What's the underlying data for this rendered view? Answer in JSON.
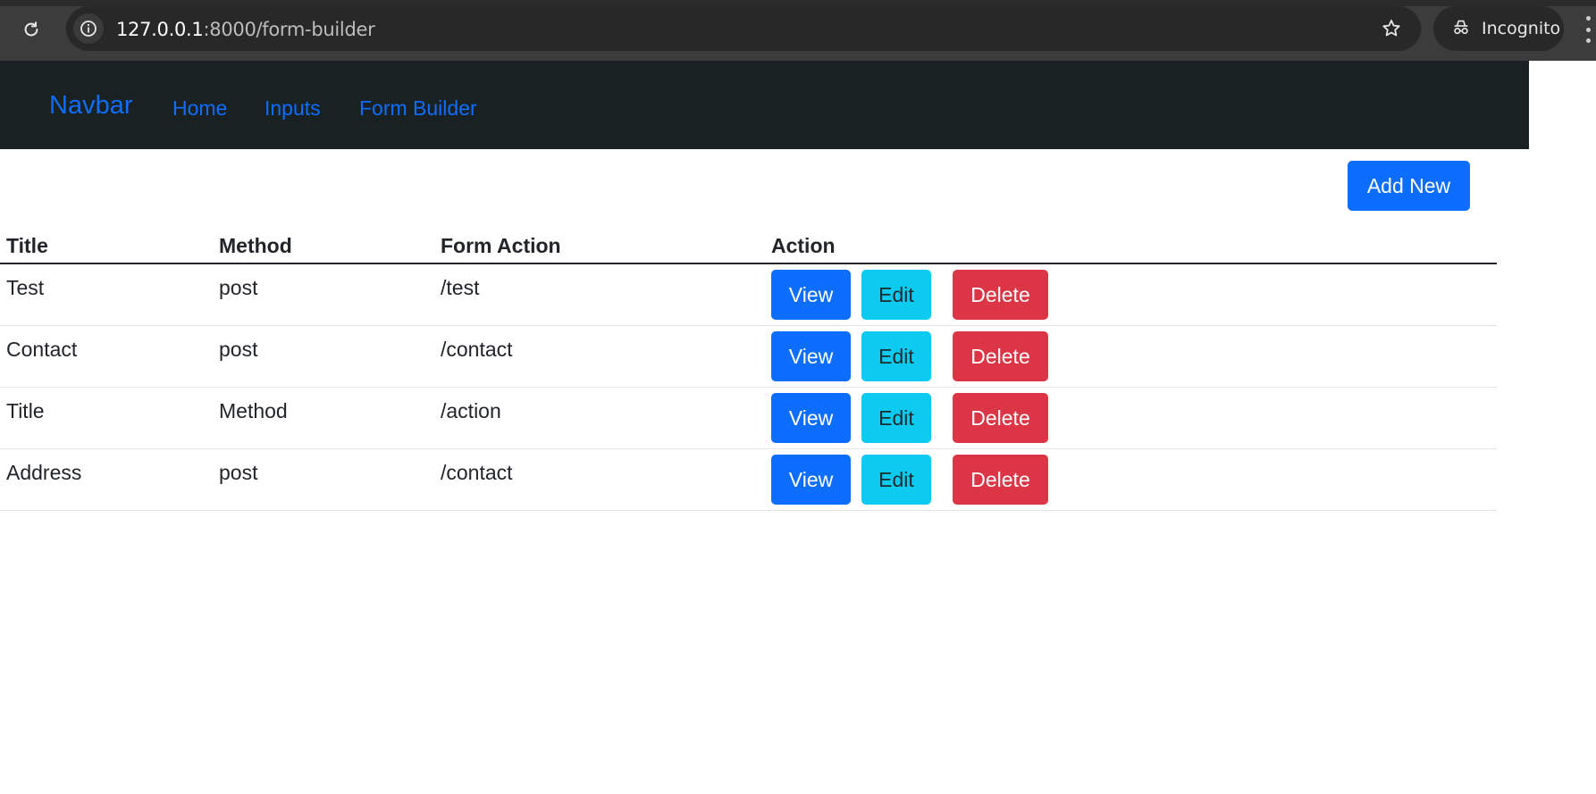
{
  "browser": {
    "url_host": "127.0.0.1",
    "url_path": ":8000/form-builder",
    "incognito_label": "Incognito"
  },
  "navbar": {
    "brand": "Navbar",
    "links": [
      "Home",
      "Inputs",
      "Form Builder"
    ]
  },
  "add_button": "Add New",
  "table": {
    "headers": [
      "Title",
      "Method",
      "Form Action",
      "Action"
    ],
    "rows": [
      {
        "title": "Test",
        "method": "post",
        "action": "/test"
      },
      {
        "title": "Contact",
        "method": "post",
        "action": "/contact"
      },
      {
        "title": "Title",
        "method": "Method",
        "action": "/action"
      },
      {
        "title": "Address",
        "method": "post",
        "action": "/contact"
      }
    ],
    "button_labels": {
      "view": "View",
      "edit": "Edit",
      "delete": "Delete"
    }
  },
  "colors": {
    "primary": "#0d6efd",
    "info": "#0dcaf0",
    "danger": "#dc3545",
    "navbar_bg": "#192122"
  }
}
